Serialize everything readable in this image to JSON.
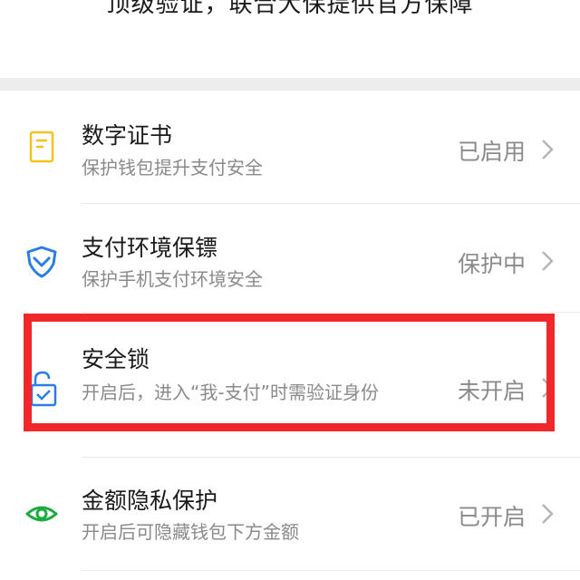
{
  "header": {
    "slogan": "顶级验证，联合大保提供官方保障"
  },
  "items": [
    {
      "title": "数字证书",
      "subtitle": "保护钱包提升支付安全",
      "status": "已启用",
      "icon": "certificate-icon",
      "icon_color": "#f2c31c"
    },
    {
      "title": "支付环境保镖",
      "subtitle": "保护手机支付环境安全",
      "status": "保护中",
      "icon": "shield-icon",
      "icon_color": "#2b7de6"
    },
    {
      "title": "安全锁",
      "subtitle": "开启后，进入“我-支付”时需验证身份",
      "status": "未开启",
      "icon": "lock-icon",
      "icon_color": "#2b7de6"
    },
    {
      "title": "金额隐私保护",
      "subtitle": "开启后可隐藏钱包下方金额",
      "status": "已开启",
      "icon": "eye-icon",
      "icon_color": "#19ad3e"
    }
  ],
  "colors": {
    "highlight": "#f1282a",
    "separator": "#ededed"
  }
}
